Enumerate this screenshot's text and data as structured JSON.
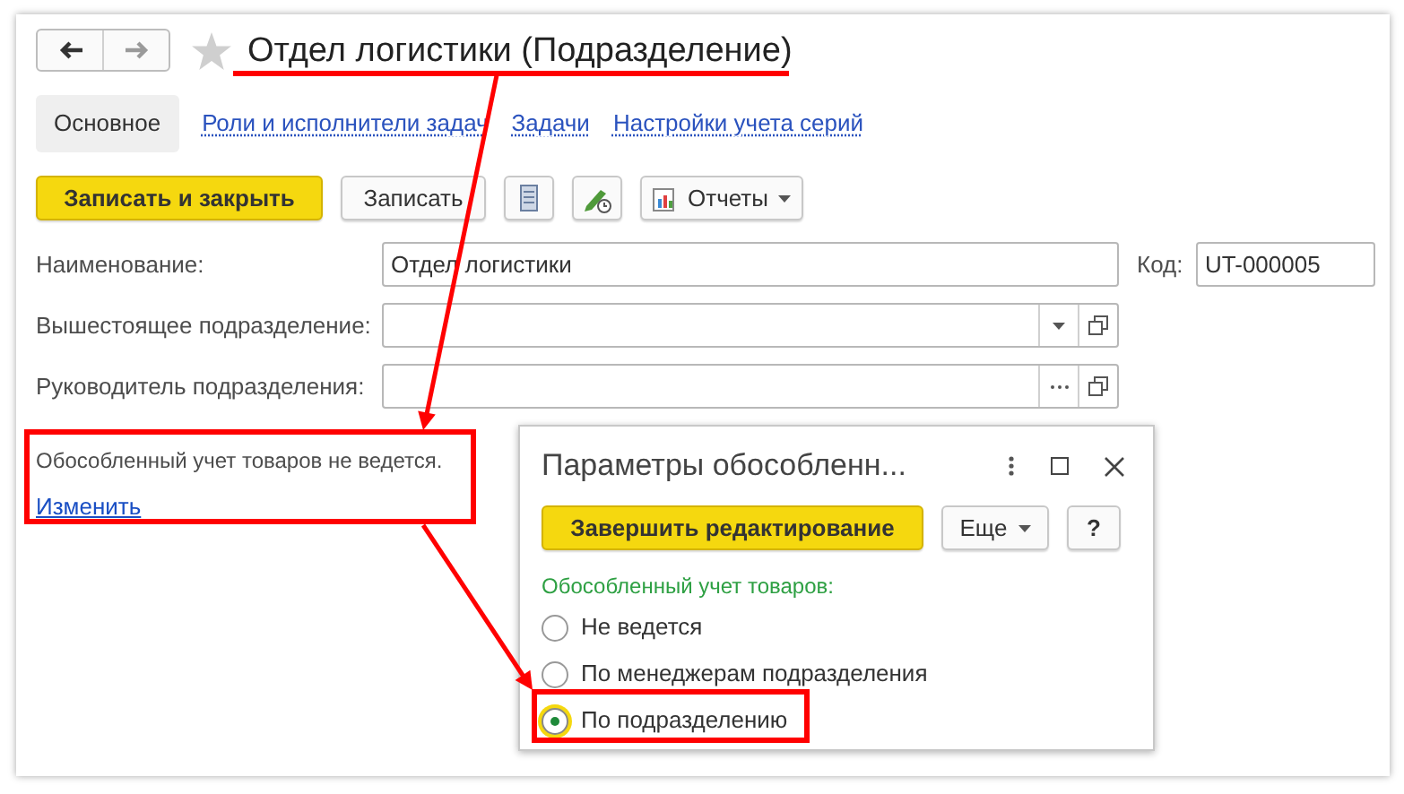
{
  "window": {
    "title": "Отдел логистики (Подразделение)"
  },
  "tabs": [
    {
      "label": "Основное",
      "selected": true
    },
    {
      "label": "Роли и исполнители задач",
      "selected": false
    },
    {
      "label": "Задачи",
      "selected": false
    },
    {
      "label": "Настройки учета серий",
      "selected": false
    }
  ],
  "toolbar": [
    {
      "kind": "primary",
      "label": "Записать и закрыть"
    },
    {
      "kind": "plain",
      "label": "Записать"
    },
    {
      "kind": "list-icon"
    },
    {
      "kind": "edit-icon"
    },
    {
      "kind": "menu",
      "label": "Отчеты"
    }
  ],
  "fields": [
    {
      "kind": "text",
      "label": "Наименование:",
      "value": "Отдел логистики",
      "code_label": "Код:",
      "code_value": "UT-000005"
    },
    {
      "kind": "dropdown",
      "label": "Вышестоящее подразделение:"
    },
    {
      "kind": "choice",
      "label": "Руководитель подразделения:"
    }
  ],
  "note": {
    "text": "Обособленный учет товаров не ведется.",
    "link": "Изменить"
  },
  "dialog": {
    "title": "Параметры обособленн...",
    "buttons": [
      {
        "kind": "primary",
        "label": "Завершить редактирование"
      },
      {
        "kind": "menu",
        "label": "Еще"
      },
      {
        "kind": "plain",
        "label": "?"
      }
    ],
    "group_label": "Обособленный учет товаров:",
    "options": [
      {
        "label": "Не ведется",
        "selected": false
      },
      {
        "label": "По менеджерам подразделения",
        "selected": false
      },
      {
        "label": "По подразделению",
        "selected": true
      }
    ]
  }
}
